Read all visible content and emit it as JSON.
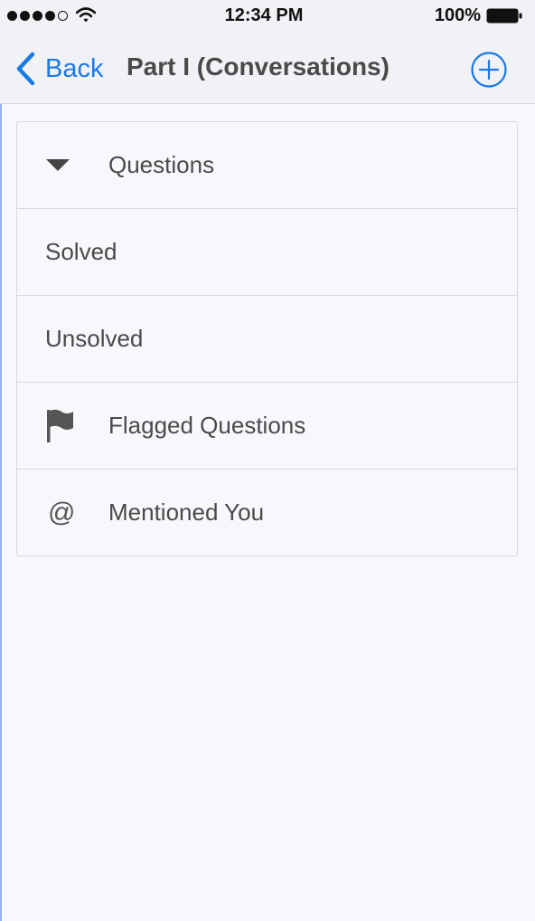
{
  "status_bar": {
    "time": "12:34 PM",
    "battery_percent": "100%",
    "signal_bars_filled": 4,
    "signal_bars_total": 5
  },
  "nav": {
    "back_label": "Back",
    "title": "Part I (Conversations)",
    "accent_color": "#1a7ae6"
  },
  "list": {
    "items": [
      {
        "label": "Questions",
        "icon": "triangle-down-icon"
      },
      {
        "label": "Solved",
        "icon": null
      },
      {
        "label": "Unsolved",
        "icon": null
      },
      {
        "label": "Flagged Questions",
        "icon": "flag-icon"
      },
      {
        "label": "Mentioned You",
        "icon": "at-icon",
        "icon_glyph": "@"
      }
    ]
  }
}
